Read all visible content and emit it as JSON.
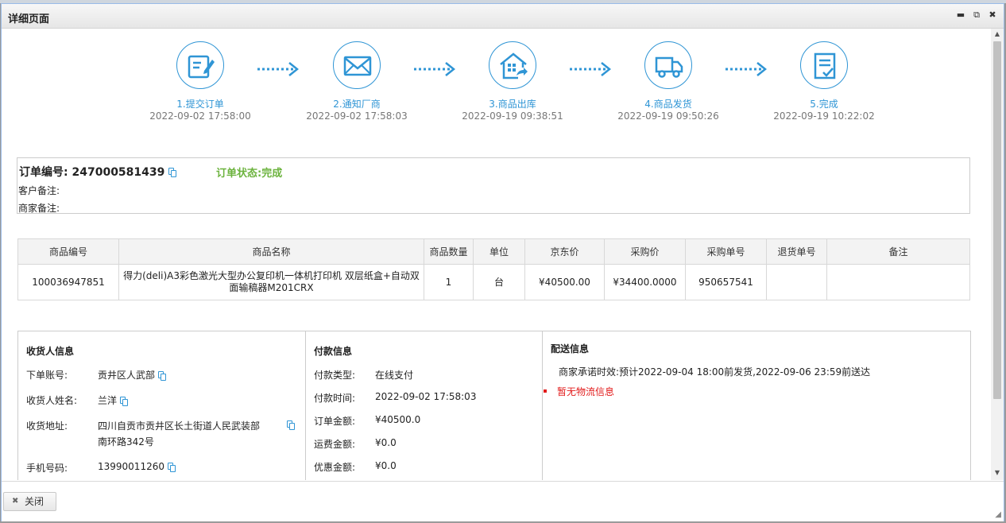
{
  "window": {
    "title": "详细页面"
  },
  "steps": [
    {
      "label": "1.提交订单",
      "time": "2022-09-02 17:58:00",
      "icon": "edit-document-icon"
    },
    {
      "label": "2.通知厂商",
      "time": "2022-09-02 17:58:03",
      "icon": "envelope-icon"
    },
    {
      "label": "3.商品出库",
      "time": "2022-09-19 09:38:51",
      "icon": "warehouse-icon"
    },
    {
      "label": "4.商品发货",
      "time": "2022-09-19 09:50:26",
      "icon": "truck-icon"
    },
    {
      "label": "5.完成",
      "time": "2022-09-19 10:22:02",
      "icon": "checklist-icon"
    }
  ],
  "order": {
    "number_label": "订单编号:",
    "number": "247000581439",
    "status_label": "订单状态:",
    "status": "完成",
    "customer_remark_label": "客户备注:",
    "merchant_remark_label": "商家备注:"
  },
  "goods": {
    "headers": [
      "商品编号",
      "商品名称",
      "商品数量",
      "单位",
      "京东价",
      "采购价",
      "采购单号",
      "退货单号",
      "备注"
    ],
    "rows": [
      [
        "100036947851",
        "得力(deli)A3彩色激光大型办公复印机一体机打印机 双层纸盒+自动双面输稿器M201CRX",
        "1",
        "台",
        "¥40500.00",
        "¥34400.0000",
        "950657541",
        "",
        ""
      ]
    ]
  },
  "receiver": {
    "title": "收货人信息",
    "account_label": "下单账号:",
    "account": "贡井区人武部",
    "name_label": "收货人姓名:",
    "name": "兰洋",
    "address_label": "收货地址:",
    "address_line1": "四川自贡市贡井区长土街道人民武装部",
    "address_line2": "南环路342号",
    "phone_label": "手机号码:",
    "phone": "13990011260"
  },
  "payment": {
    "title": "付款信息",
    "type_label": "付款类型:",
    "type": "在线支付",
    "time_label": "付款时间:",
    "time": "2022-09-02 17:58:03",
    "amount_label": "订单金额:",
    "amount": "¥40500.0",
    "freight_label": "运费金额:",
    "freight": "¥0.0",
    "discount_label": "优惠金额:",
    "discount": "¥0.0"
  },
  "delivery": {
    "title": "配送信息",
    "promise": "商家承诺时效:预计2022-09-04 18:00前发货,2022-09-06 23:59前送达",
    "logistics": "暂无物流信息"
  },
  "footer": {
    "close_label": "关闭"
  },
  "colors": {
    "accent": "#2f95d5",
    "status_green": "#6cb33e",
    "error_red": "#e21b1b"
  }
}
